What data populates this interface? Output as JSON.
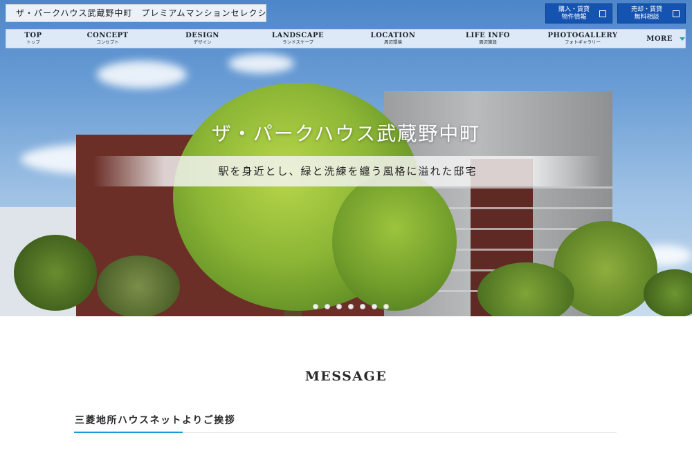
{
  "header": {
    "site_title": "ザ・パークハウス武蔵野中町　プレミアムマンションセレクション",
    "buttons": [
      {
        "line1": "購入・賃貸",
        "line2": "物件情報"
      },
      {
        "line1": "売却・賃貸",
        "line2": "無料相談"
      }
    ]
  },
  "nav": {
    "items": [
      {
        "en": "TOP",
        "ja": "トップ"
      },
      {
        "en": "CONCEPT",
        "ja": "コンセプト"
      },
      {
        "en": "DESIGN",
        "ja": "デザイン"
      },
      {
        "en": "LANDSCAPE",
        "ja": "ランドスケープ"
      },
      {
        "en": "LOCATION",
        "ja": "周辺環境"
      },
      {
        "en": "LIFE INFO",
        "ja": "周辺施設"
      },
      {
        "en": "PHOTOGALLERY",
        "ja": "フォトギャラリー"
      }
    ],
    "more_label": "MORE"
  },
  "hero": {
    "title": "ザ・パークハウス武蔵野中町",
    "catch": "駅を身近とし、緑と洗練を纏う風格に溢れた邸宅",
    "slide_count": 7
  },
  "message": {
    "title": "MESSAGE",
    "subtitle": "三菱地所ハウスネットよりご挨拶"
  },
  "colors": {
    "accent_blue": "#1553b0",
    "rule_accent": "#1a9ad6"
  }
}
